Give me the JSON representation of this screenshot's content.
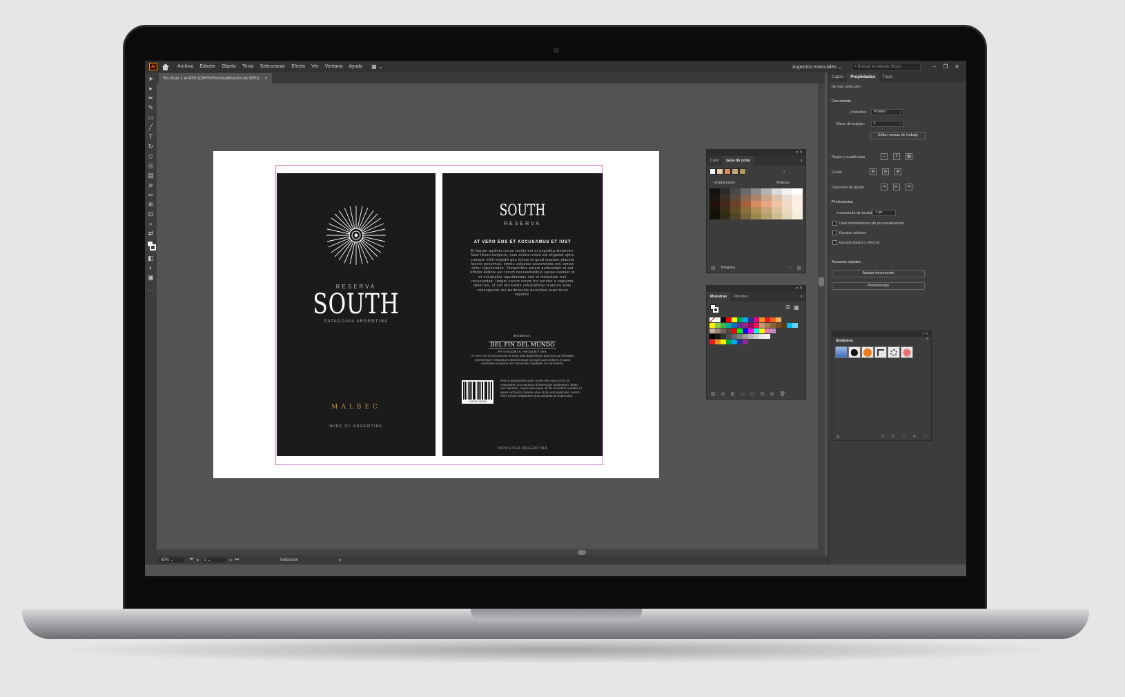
{
  "menubar": {
    "app_logo": "Ai",
    "items": [
      "Archivo",
      "Edición",
      "Objeto",
      "Texto",
      "Seleccionar",
      "Efecto",
      "Ver",
      "Ventana",
      "Ayuda"
    ],
    "workspace": "Aspectos esenciales",
    "search_placeholder": "Buscar en Adobe Stock",
    "window_controls": [
      "–",
      "❐",
      "✕"
    ]
  },
  "document_tab": {
    "title": "Sin título-1 al 40% (CMYK/Previsualización de GPU)",
    "close": "×"
  },
  "label_front": {
    "reserva": "RESERVA",
    "brand": "SOUTH",
    "origin": "PATAGONIA ARGENTINA",
    "varietal": "MALBEC",
    "tagline": "WINE OF ARGENTINE"
  },
  "label_back": {
    "brand": "SOUTH",
    "reserva": "RESERVA",
    "heading": "AT VERO EOS ET ACCUSAMUS ET IUST",
    "body": "Et harum quidem rerum facilis est et expedita distinctio. Nam libero tempore, cum soluta nobis est eligendi optio cumque nihil impedit quo minus id quod maxime placeat facere possimus, omnis voluptas assumenda est, omnis dolor repellendus. Temporibus autem quibusdam et aut officiis debitis aut rerum necessitatibus saepe eveniet ut et voluptates repudiandae sint et molestiae non recusandae. Itaque earum rerum hic tenetur a sapiente delectus, ut aut reiciendis voluptatibus maiores alias consequatur aut perferendis doloribus asperiores repellat.",
    "bodega_small": "BODEGA",
    "bodega_name": "DEL FIN DEL MUNDO",
    "bodega_region": "PATAGONIA ARGENTINA",
    "body2": "At vero eos et accusamus et iusto odio dignissimos ducimus qui blanditiis praesentium voluptatum deleniti atque corrupti quos dolores et quas molestias excepturi sint occaecati cupiditate non provident.",
    "barcode_number": "0 000000 000000",
    "body3": "Sed ut perspiciatis unde omnis iste natus error sit voluptatem accusantium doloremque laudantium, totam rem aperiam, eaque ipsa quae ab illo inventore veritatis et quasi architecto beatae vitae dicta sunt explicabo. Nemo enim ipsam voluptatem quia voluptas sit aspernatur.",
    "footer": "INDUSTRIA ARGENTINA"
  },
  "color_guide_panel": {
    "tabs": [
      "Color",
      "Guía de color"
    ],
    "shades_label": "Gradaciones",
    "tints_label": "Matices",
    "harmony_label": "Ninguna",
    "harmony_colors": [
      "#ffffff",
      "#e7c7a8",
      "#d98b5f",
      "#c8a47a",
      "#b59a5a"
    ],
    "grid_colors": [
      [
        "#111111",
        "#2b2b2b",
        "#4a4a4a",
        "#6b6b6b",
        "#8c8c8c",
        "#b5b5b5",
        "#dcdcdc",
        "#f2f2f2",
        "#ffffff"
      ],
      [
        "#1a1511",
        "#3b2f26",
        "#5d4a3c",
        "#8a6b55",
        "#b08469",
        "#c9a48a",
        "#dcc3ae",
        "#ecdccd",
        "#f8f0e8"
      ],
      [
        "#1e120b",
        "#45291a",
        "#6e422a",
        "#a45f3b",
        "#d98b5f",
        "#e6a67f",
        "#eec2a3",
        "#f5dcc8",
        "#fbefe5"
      ],
      [
        "#181309",
        "#3b2f18",
        "#5e4b27",
        "#8b6f3c",
        "#b08f55",
        "#c8a47a",
        "#dbc19f",
        "#ebdac2",
        "#f7efe2"
      ],
      [
        "#131009",
        "#312a17",
        "#514527",
        "#776739",
        "#9a884e",
        "#b5a26b",
        "#cdbe92",
        "#e2d7b9",
        "#f3eedd"
      ]
    ]
  },
  "swatches_panel": {
    "tabs": [
      "Muestras",
      "Pinceles"
    ],
    "rows": [
      [
        "none",
        "#ffffff",
        "#000000",
        "#ff0000",
        "#ffff00",
        "#00a651",
        "#00aeef",
        "#2e3192",
        "#ec008c",
        "#f7941d",
        "#ed1c24",
        "#f26522",
        "#fbaf5d"
      ],
      [
        "#fff200",
        "#8dc63f",
        "#39b54a",
        "#00a99d",
        "#0072bc",
        "#662d91",
        "#92278f",
        "#9e005d",
        "#ed145b",
        "#c69c6d",
        "#a67c52",
        "#8c6239",
        "#754c24",
        "#603913",
        "#00bff3",
        "#6dcff6"
      ],
      [
        "#c7b299",
        "#998675",
        "#736357",
        "#534741",
        "#ff0000",
        "#00ff00",
        "#0000ff",
        "#ff00ff",
        "#00ffff",
        "#ffff00",
        "#f06eaa",
        "#bd8cbf"
      ],
      [
        "#000000",
        "#1a1a1a",
        "#333333",
        "#4d4d4d",
        "#666666",
        "#808080",
        "#999999",
        "#b3b3b3",
        "#cccccc",
        "#e6e6e6",
        "#f2f2f2"
      ],
      [
        "#ed1c24",
        "#f7941d",
        "#fff200",
        "#00a651",
        "#00aeef",
        "#2e3192",
        "#92278f"
      ]
    ]
  },
  "properties_panel": {
    "tabs": [
      "Capas",
      "Propiedades",
      "Trazo"
    ],
    "no_selection": "No hay selección",
    "document_heading": "Documento",
    "units_label": "Unidades:",
    "units_value": "Píxeles",
    "artboard_label": "Mesa de trabajo:",
    "artboard_value": "1",
    "edit_artboards_button": "Editar mesas de trabajo",
    "rulers_grids_label": "Regla y cuadrículas",
    "guides_label": "Guías",
    "snap_label": "Opciones de ajuste",
    "preferences_heading": "Preferencias",
    "keyboard_increment_label": "Incremento de teclado:",
    "keyboard_increment_value": "1 px",
    "chk_preview_bounds": "Usar delimitadores de previsualización",
    "chk_scale_corners": "Escalar vértices",
    "chk_scale_strokes": "Escalar trazos y efectos",
    "quick_actions_heading": "Acciones rápidas",
    "fit_document_button": "Ajustar documento",
    "preferences_button": "Preferencias",
    "symbols_title": "Símbolos"
  },
  "statusbar": {
    "zoom": "40%",
    "artboard_number": "1",
    "tool": "Selección"
  }
}
